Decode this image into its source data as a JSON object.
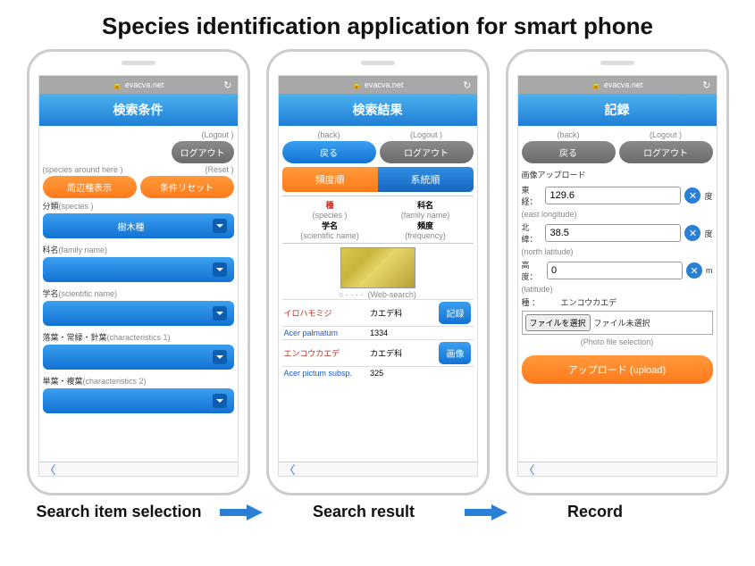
{
  "title": "Species identification application for smart phone",
  "url": "evacva.net",
  "captions": {
    "c1": "Search item selection",
    "c2": "Search result",
    "c3": "Record"
  },
  "phone1": {
    "header": "検索条件",
    "ann_logout": "(Logout )",
    "btn_logout": "ログアウト",
    "ann_species_around": "(species around here )",
    "ann_reset": "(Reset )",
    "btn_around": "周辺種表示",
    "btn_reset": "条件リセット",
    "f1_label": "分類",
    "f1_ann": "(species )",
    "f1_val": "樹木種",
    "f2_label": "科名",
    "f2_ann": "(family name)",
    "f3_label": "学名",
    "f3_ann": "(scientific name)",
    "f4_label": "落葉・常緑・針葉",
    "f4_ann": "(characteristics 1)",
    "f5_label": "単葉・複葉",
    "f5_ann": "(characteristics 2)"
  },
  "phone2": {
    "header": "検索結果",
    "ann_back": "(back)",
    "ann_logout": "(Logout )",
    "btn_back": "戻る",
    "btn_logout": "ログアウト",
    "tab1": "頻度順",
    "tab2": "系統順",
    "col_species_jp": "種",
    "col_species_en": "(species )",
    "col_family_jp": "科名",
    "col_family_en": "(family name)",
    "col_sci_jp": "学名",
    "col_sci_en": "(scientific name)",
    "col_freq_jp": "頻度",
    "col_freq_en": "(frequency)",
    "websearch": "(Web-search)",
    "btn_record": "記録",
    "btn_image": "画像",
    "r1_jp": "イロハモミジ",
    "r1_fam": "カエデ科",
    "r1_sci": "Acer palmatum",
    "r1_freq": "1334",
    "r2_jp": "エンコウカエデ",
    "r2_fam": "カエデ科",
    "r2_sci": "Acer pictum subsp.",
    "r2_freq": "325"
  },
  "phone3": {
    "header": "記録",
    "ann_back": "(back)",
    "ann_logout": "(Logout )",
    "btn_back": "戻る",
    "btn_logout": "ログアウト",
    "section": "画像アップロード",
    "lon_label": "東経：",
    "lon_val": "129.6",
    "lon_unit": "度",
    "lon_ann": "(east longitude)",
    "lat_label": "北緯：",
    "lat_val": "38.5",
    "lat_unit": "度",
    "lat_ann": "(north latitude)",
    "alt_label": "高度：",
    "alt_val": "0",
    "alt_unit": "m",
    "alt_ann": "(latitude)",
    "species_label": "種 ：",
    "species_val": "エンコウカエデ",
    "file_btn": "ファイルを選択",
    "file_none": "ファイル未選択",
    "file_ann": "(Photo file selection)",
    "upload": "アップロード (upload)"
  }
}
